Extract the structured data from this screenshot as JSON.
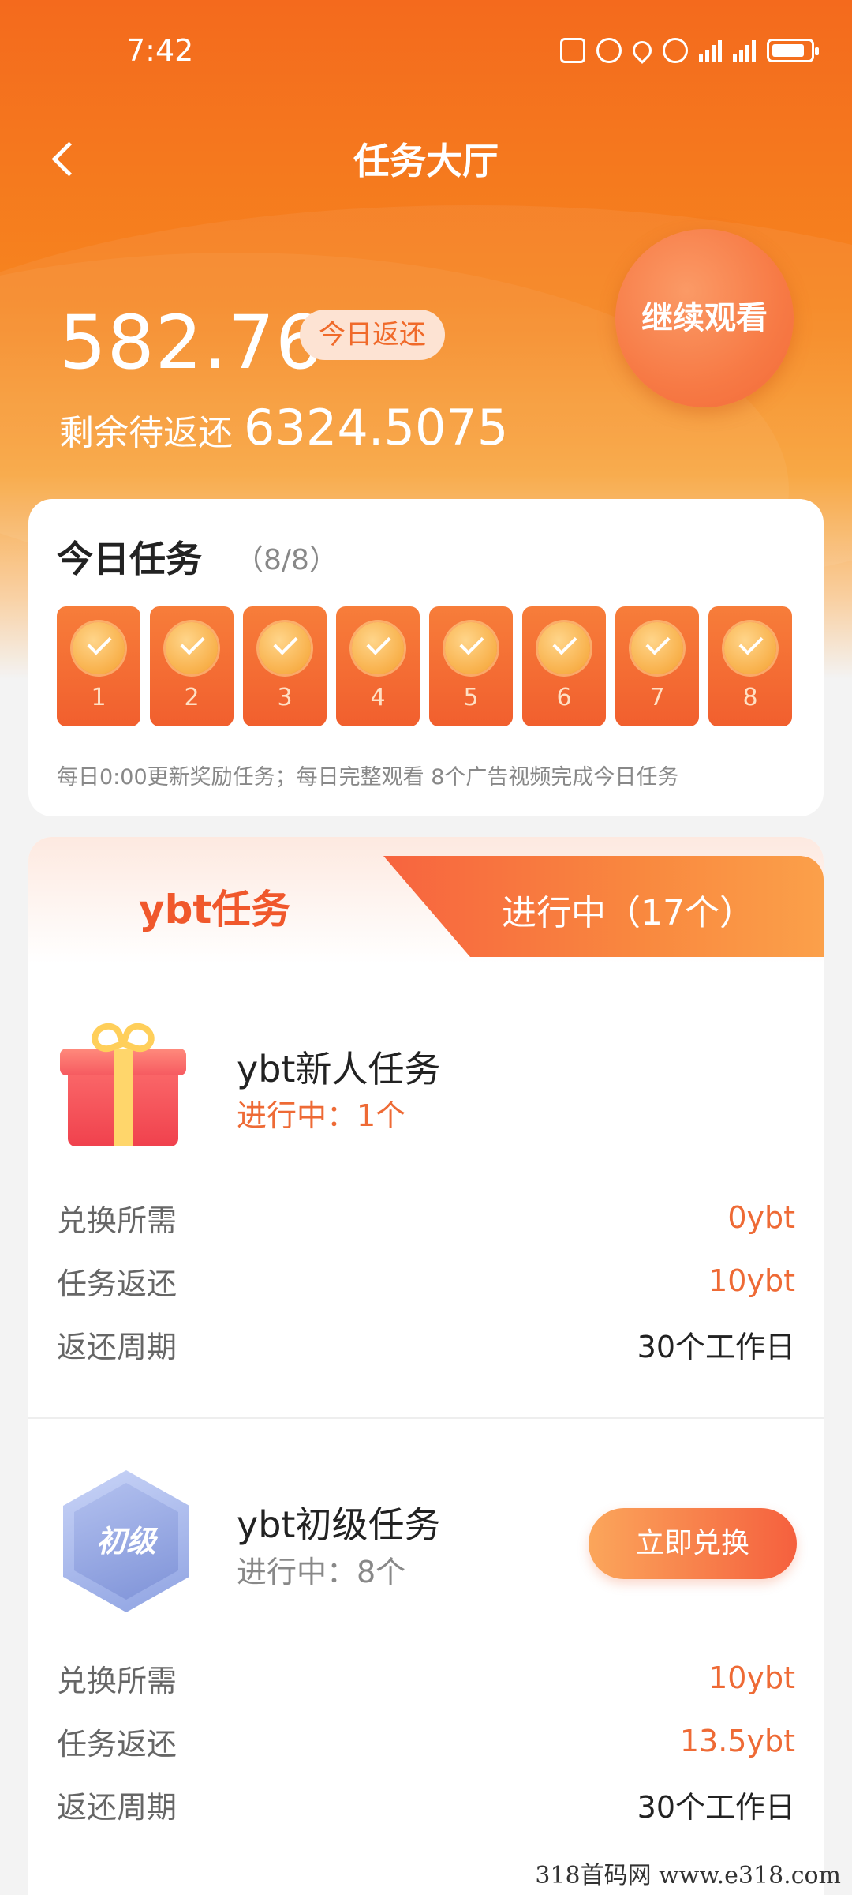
{
  "status_bar": {
    "time": "7:42"
  },
  "nav": {
    "title": "任务大厅"
  },
  "summary": {
    "balance": "582.76",
    "today_badge": "今日返还",
    "remaining_label": "剩余待返还",
    "remaining_value": "6324.5075",
    "continue_button": "继续观看"
  },
  "today_tasks": {
    "title": "今日任务",
    "count": "（8/8）",
    "days": [
      "1",
      "2",
      "3",
      "4",
      "5",
      "6",
      "7",
      "8"
    ],
    "note": "每日0:00更新奖励任务；每日完整观看 8个广告视频完成今日任务"
  },
  "ybt_section": {
    "tab_left": "ybt任务",
    "tab_right": "进行中（17个）",
    "tasks": [
      {
        "name": "ybt新人任务",
        "status": "进行中：1个",
        "rows": [
          {
            "label": "兑换所需",
            "value": "0ybt"
          },
          {
            "label": "任务返还",
            "value": "10ybt"
          },
          {
            "label": "返还周期",
            "value": "30个工作日"
          }
        ]
      },
      {
        "name": "ybt初级任务",
        "badge": "初级",
        "status": "进行中：8个",
        "button": "立即兑换",
        "rows": [
          {
            "label": "兑换所需",
            "value": "10ybt"
          },
          {
            "label": "任务返还",
            "value": "13.5ybt"
          },
          {
            "label": "返还周期",
            "value": "30个工作日"
          }
        ]
      }
    ]
  },
  "watermark": "318首码网 www.e318.com",
  "colors": {
    "primary": "#f46a1d",
    "accent": "#ee6a35",
    "card": "#ffffff"
  }
}
